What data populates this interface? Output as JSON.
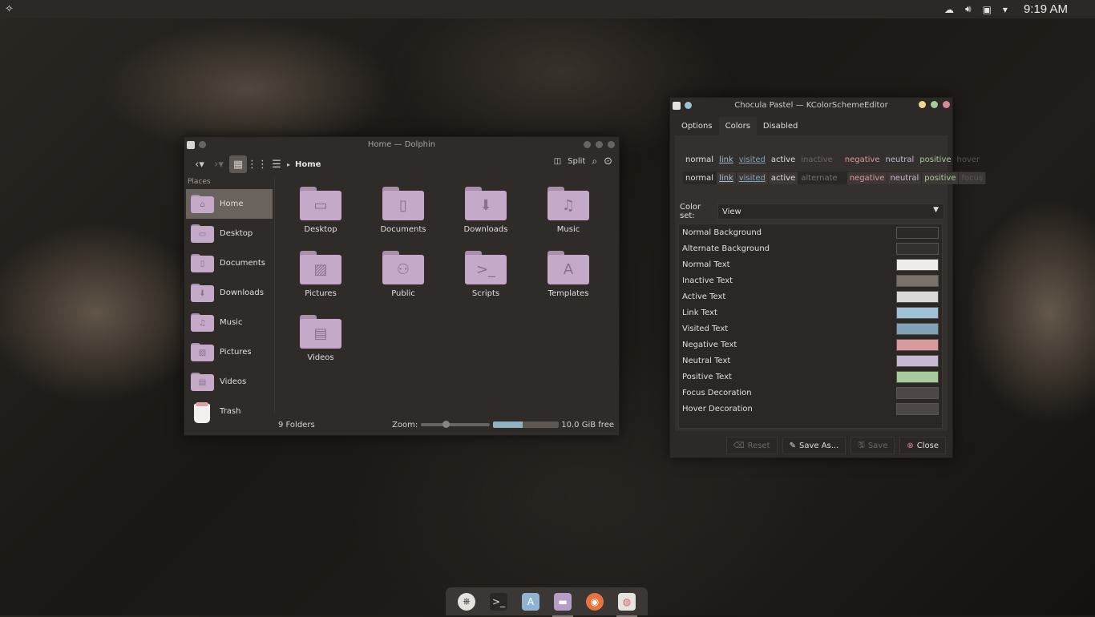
{
  "topbar": {
    "clock": "9:19 AM"
  },
  "dolphin": {
    "title": "Home — Dolphin",
    "breadcrumb": "Home",
    "split_label": "Split",
    "places_header": "Places",
    "places": [
      {
        "label": "Home",
        "icon": "home-icon"
      },
      {
        "label": "Desktop",
        "icon": "desktop-icon"
      },
      {
        "label": "Documents",
        "icon": "document-icon"
      },
      {
        "label": "Downloads",
        "icon": "download-icon"
      },
      {
        "label": "Music",
        "icon": "music-icon"
      },
      {
        "label": "Pictures",
        "icon": "picture-icon"
      },
      {
        "label": "Videos",
        "icon": "video-icon"
      },
      {
        "label": "Trash",
        "icon": "trash-icon"
      }
    ],
    "files": [
      {
        "label": "Desktop",
        "icon": "desktop-icon"
      },
      {
        "label": "Documents",
        "icon": "document-icon"
      },
      {
        "label": "Downloads",
        "icon": "download-icon"
      },
      {
        "label": "Music",
        "icon": "music-icon"
      },
      {
        "label": "Pictures",
        "icon": "picture-icon"
      },
      {
        "label": "Public",
        "icon": "people-icon"
      },
      {
        "label": "Scripts",
        "icon": "terminal-icon"
      },
      {
        "label": "Templates",
        "icon": "template-icon"
      },
      {
        "label": "Videos",
        "icon": "video-icon"
      }
    ],
    "status": {
      "count": "9 Folders",
      "zoom_label": "Zoom:",
      "free": "10.0 GiB free",
      "zoom_level": 0.35,
      "disk_used": 0.45
    }
  },
  "kcs": {
    "title": "Chocula Pastel — KColorSchemeEditor",
    "tabs": [
      "Options",
      "Colors",
      "Disabled"
    ],
    "active_tab": "Colors",
    "preview_row1": [
      "normal",
      "link",
      "visited",
      "active",
      "inactive",
      "negative",
      "neutral",
      "positive",
      "hover"
    ],
    "preview_row2": [
      "normal",
      "link",
      "visited",
      "active",
      "alternate",
      "negative",
      "neutral",
      "positive",
      "focus"
    ],
    "colorset_label": "Color set:",
    "colorset_value": "View",
    "colors": [
      {
        "name": "Normal Background",
        "color": "#2b2826"
      },
      {
        "name": "Alternate Background",
        "color": "#34302d"
      },
      {
        "name": "Normal Text",
        "color": "#eeeceb"
      },
      {
        "name": "Inactive Text",
        "color": "#7a716a"
      },
      {
        "name": "Active Text",
        "color": "#dcd8d5"
      },
      {
        "name": "Link Text",
        "color": "#9ec1d6"
      },
      {
        "name": "Visited Text",
        "color": "#7ea3b5"
      },
      {
        "name": "Negative Text",
        "color": "#d99a9e"
      },
      {
        "name": "Neutral Text",
        "color": "#c7b9d3"
      },
      {
        "name": "Positive Text",
        "color": "#a6cb9c"
      },
      {
        "name": "Focus Decoration",
        "color": "#4d4845"
      },
      {
        "name": "Hover Decoration",
        "color": "#4d4845"
      }
    ],
    "buttons": {
      "reset": "Reset",
      "save_as": "Save As...",
      "save": "Save",
      "close": "Close"
    }
  },
  "dock": [
    "steering-wheel-icon",
    "terminal-icon",
    "app-store-icon",
    "files-icon",
    "firefox-icon",
    "color-picker-icon"
  ]
}
